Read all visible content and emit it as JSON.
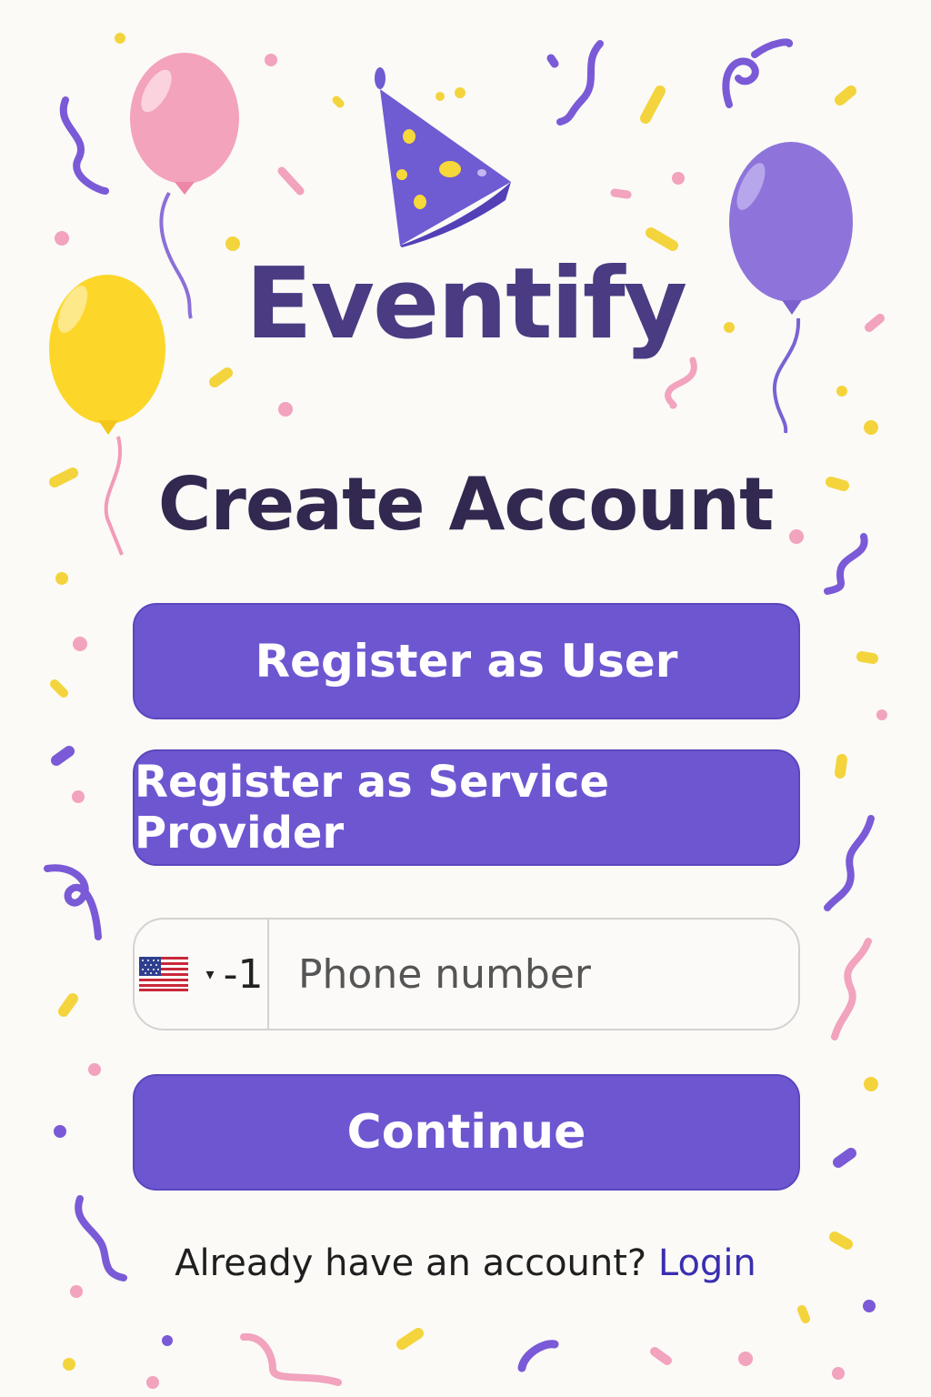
{
  "app": {
    "brand_name": "Eventify"
  },
  "header": {
    "title": "Create Account"
  },
  "actions": {
    "register_user_label": "Register as User",
    "register_provider_label": "Register as Service Provider",
    "continue_label": "Continue"
  },
  "phone": {
    "country_flag_icon": "us-flag-icon",
    "dial_code": "-1",
    "placeholder": "Phone number",
    "value": ""
  },
  "footer": {
    "prompt": "Already have an account?",
    "login_label": "Login"
  },
  "colors": {
    "brand": "#4a3b82",
    "button": "#6e56d1",
    "heading": "#33284f",
    "link": "#3a2fb0",
    "confetti": [
      "#7a5ad6",
      "#f4d43c",
      "#f2a3bd"
    ]
  },
  "decorations": [
    "pink-balloon-icon",
    "yellow-balloon-icon",
    "purple-balloon-icon",
    "party-hat-icon",
    "confetti-icon"
  ]
}
